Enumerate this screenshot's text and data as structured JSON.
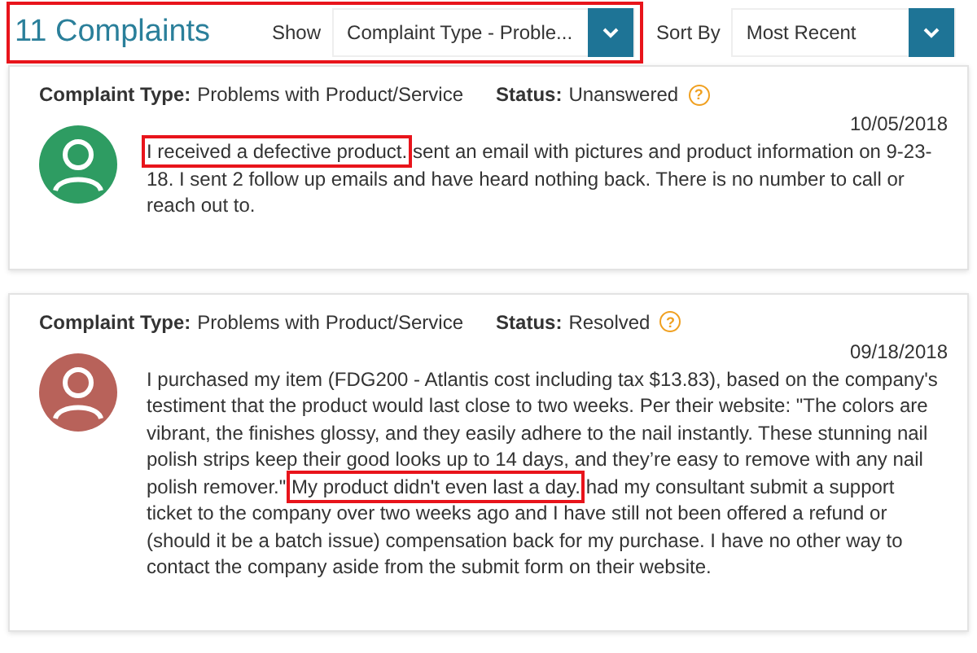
{
  "header": {
    "title": "11 Complaints",
    "filter_label": "Show",
    "filter_value": "Complaint Type - Proble...",
    "highlighted": true,
    "sort_label": "Sort By",
    "sort_value": "Most Recent"
  },
  "complaints": [
    {
      "type_label": "Complaint Type:",
      "type": "Problems with Product/Service",
      "status_label": "Status:",
      "status": "Unanswered",
      "help": "?",
      "color": "#2e9c62",
      "date": "10/05/2018",
      "text": [
        {
          "text": "I received a defective product.",
          "highlighted": true
        },
        {
          "text": "sent an email with pictures and product information on 9-23-18. I sent 2 follow up emails and have heard nothing back. There is no number to call or reach out to.",
          "highlighted": false
        }
      ]
    },
    {
      "type_label": "Complaint Type:",
      "type": "Problems with Product/Service",
      "status_label": "Status:",
      "status": "Resolved",
      "help": "?",
      "color": "#b8625a",
      "date": "09/18/2018",
      "text": [
        {
          "text": "I purchased my item (FDG200 - Atlantis cost including tax $13.83), based on the company's testiment that the product would last close to two weeks. Per their website: \"The colors are vibrant, the finishes glossy, and they easily adhere to the nail instantly. These stunning nail polish strips keep their good looks up to 14 days, and they’re easy to remove with any nail polish remover.\"",
          "highlighted": false
        },
        {
          "text": "My product didn't even last a day.",
          "highlighted": true
        },
        {
          "text": "had my consultant submit a support ticket to the company over two weeks ago and I have still not been offered a refund or (should it be a batch issue) compensation back for my purchase. I have no other way to contact the company aside from the submit form on their website.",
          "highlighted": false
        }
      ]
    }
  ]
}
